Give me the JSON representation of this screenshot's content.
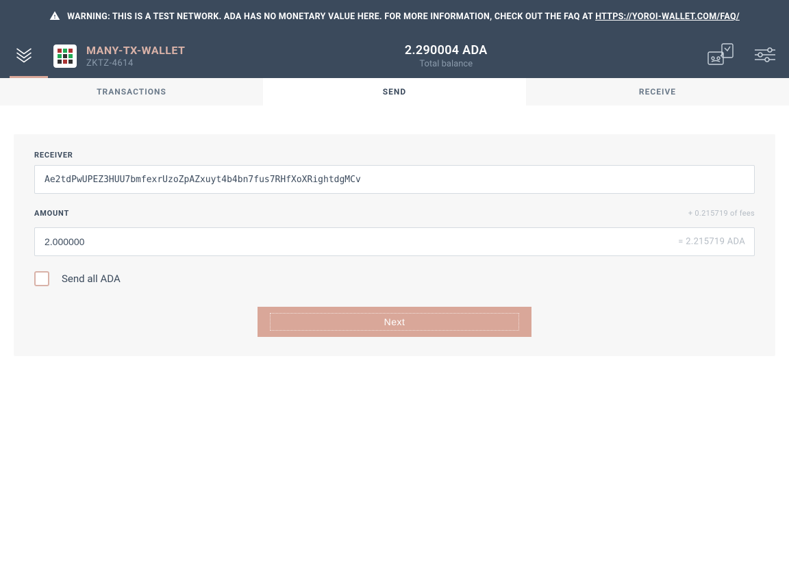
{
  "warning": {
    "prefix": "WARNING: THIS IS A TEST NETWORK. ADA HAS NO MONETARY VALUE HERE. FOR MORE INFORMATION, CHECK OUT THE FAQ AT ",
    "link_text": "HTTPS://YOROI-WALLET.COM/FAQ/"
  },
  "header": {
    "wallet_name": "MANY-TX-WALLET",
    "wallet_id": "ZKTZ-4614",
    "balance_amount": "2.290004 ADA",
    "balance_label": "Total balance"
  },
  "tabs": {
    "transactions": "TRANSACTIONS",
    "send": "SEND",
    "receive": "RECEIVE",
    "active": "send"
  },
  "form": {
    "receiver_label": "RECEIVER",
    "receiver_value": "Ae2tdPwUPEZ3HUU7bmfexrUzoZpAZxuyt4b4bn7fus7RHfXoXRightdgMCv",
    "amount_label": "AMOUNT",
    "fees_hint": "+ 0.215719 of fees",
    "amount_value": "2.000000",
    "amount_total": "= 2.215719 ADA",
    "send_all_label": "Send all ADA",
    "next_label": "Next"
  },
  "colors": {
    "header_bg": "#3b4a5c",
    "accent": "#d9a799",
    "wallet_name": "#d9b2a8"
  }
}
